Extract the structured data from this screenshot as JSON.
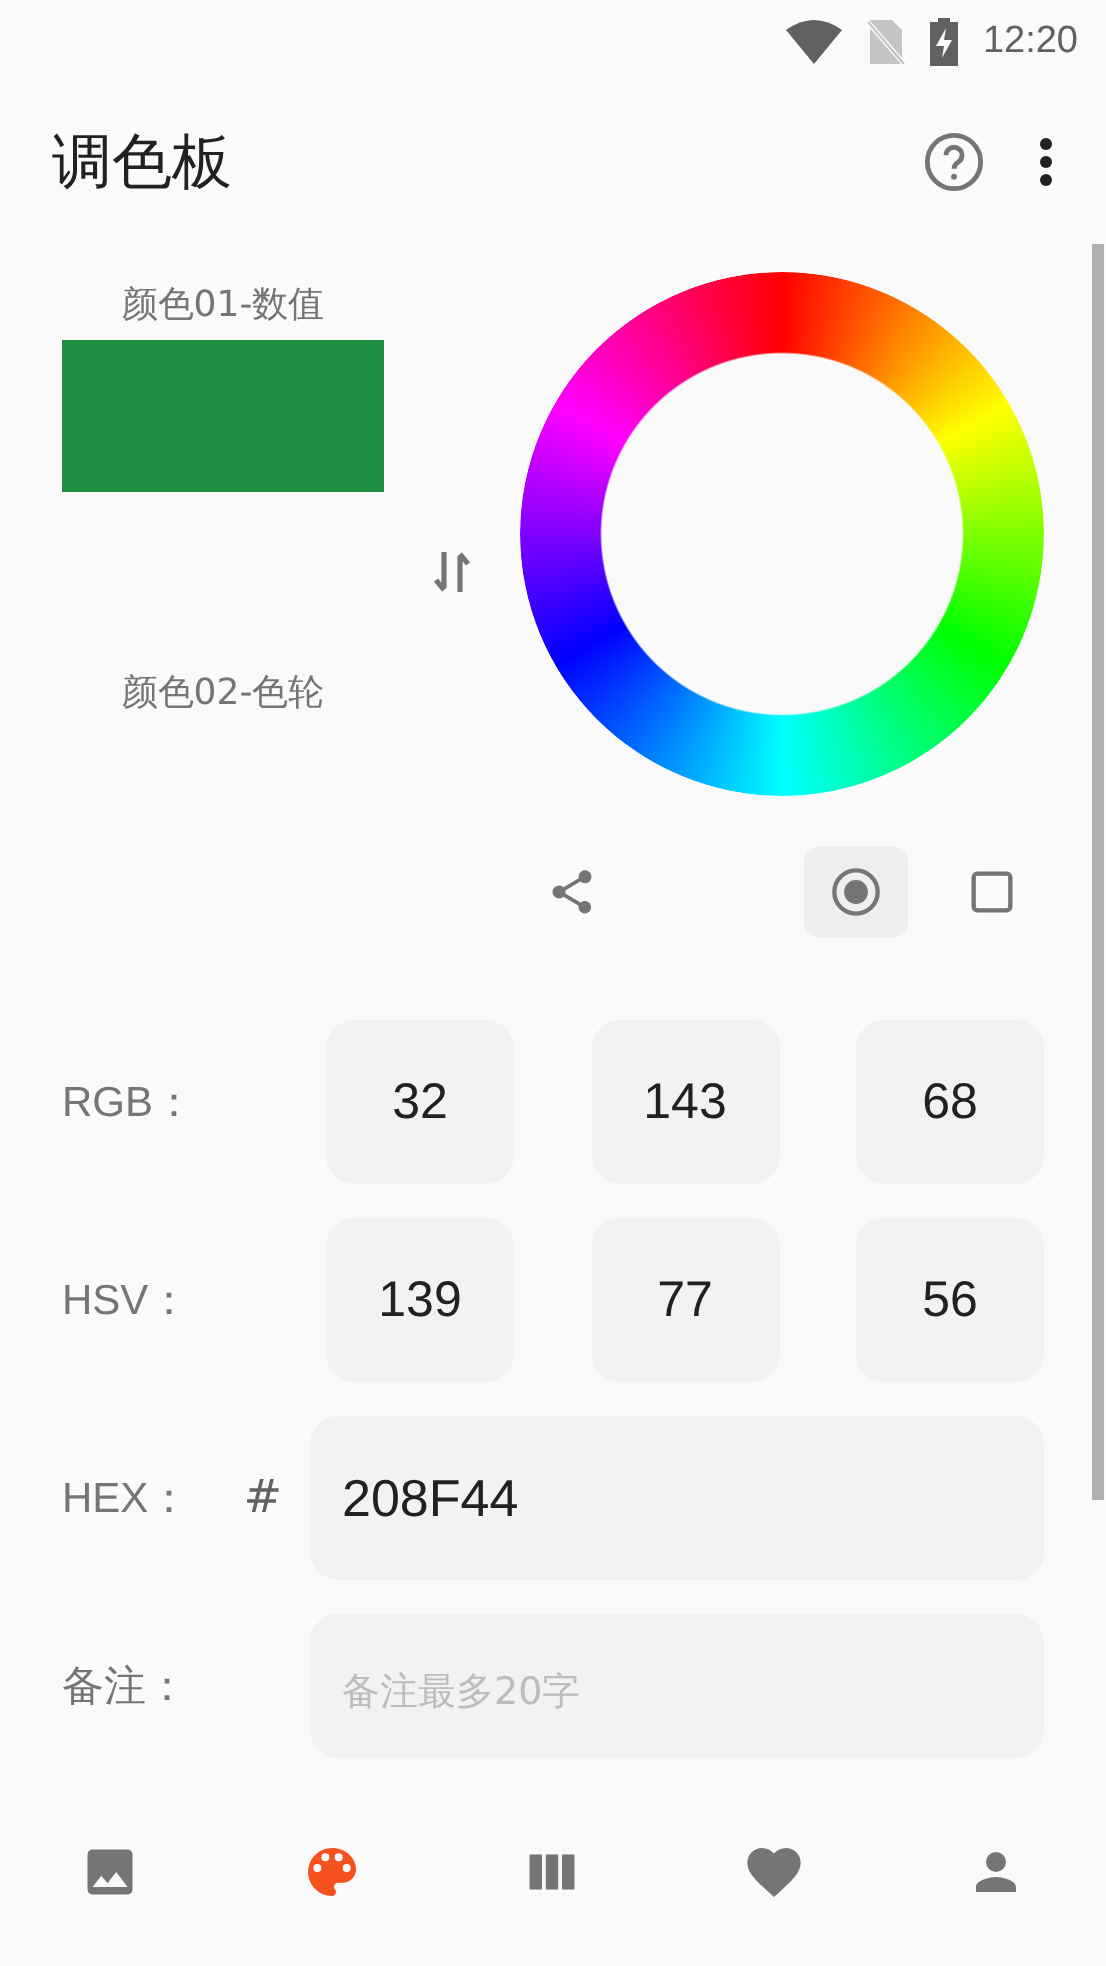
{
  "status_bar": {
    "time": "12:20"
  },
  "app_bar": {
    "title": "调色板"
  },
  "colors": [
    {
      "label": "颜色01-数值",
      "color": "#208f44"
    },
    {
      "label": "颜色02-色轮"
    }
  ],
  "modes": [
    {
      "kind": "circle",
      "selected": true
    },
    {
      "kind": "square",
      "selected": false
    }
  ],
  "rows": [
    {
      "kind": "triple",
      "label": "RGB：",
      "values": [
        "32",
        "143",
        "68"
      ]
    },
    {
      "kind": "triple",
      "label": "HSV：",
      "values": [
        "139",
        "77",
        "56"
      ]
    },
    {
      "kind": "hex",
      "label": "HEX：",
      "prefix": "#",
      "value": "208F44"
    },
    {
      "kind": "note",
      "label": "备注：",
      "placeholder": "备注最多20字"
    }
  ],
  "nav": [
    {
      "kind": "image",
      "selected": false
    },
    {
      "kind": "palette",
      "selected": true
    },
    {
      "kind": "columns",
      "selected": false
    },
    {
      "kind": "heart",
      "selected": false
    },
    {
      "kind": "person",
      "selected": false
    }
  ]
}
